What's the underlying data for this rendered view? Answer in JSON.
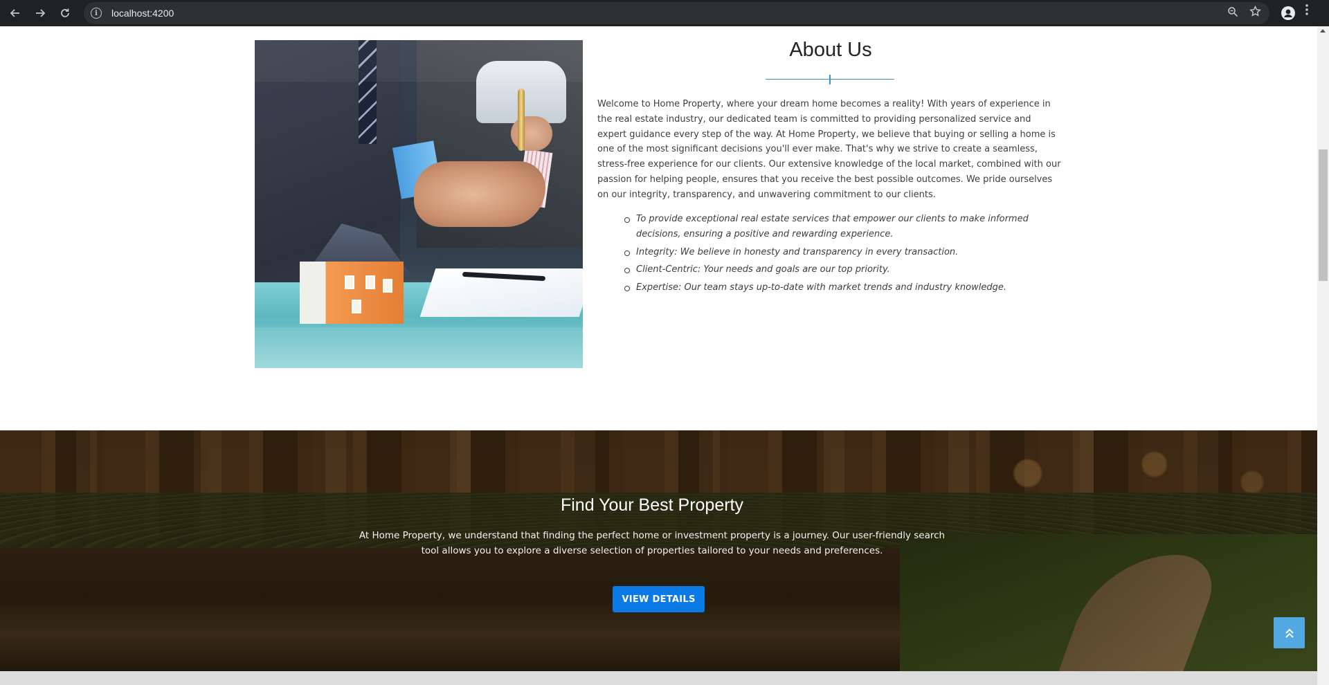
{
  "browser": {
    "url": "localhost:4200",
    "icons": {
      "back": "arrow-left-icon",
      "forward": "arrow-right-icon",
      "reload": "reload-icon",
      "site_info": "info-icon",
      "zoom": "zoom-icon",
      "bookmark": "star-icon",
      "profile": "profile-icon",
      "menu": "kebab-menu-icon"
    }
  },
  "about": {
    "title": "About Us",
    "image_alt": "Handshake over a model house and contract",
    "paragraph": "Welcome to Home Property, where your dream home becomes a reality! With years of experience in the real estate industry, our dedicated team is committed to providing personalized service and expert guidance every step of the way. At Home Property, we believe that buying or selling a home is one of the most significant decisions you'll ever make. That's why we strive to create a seamless, stress-free experience for our clients. Our extensive knowledge of the local market, combined with our passion for helping people, ensures that you receive the best possible outcomes. We pride ourselves on our integrity, transparency, and unwavering commitment to our clients.",
    "points": [
      "To provide exceptional real estate services that empower our clients to make informed decisions, ensuring a positive and rewarding experience.",
      "Integrity: We believe in honesty and transparency in every transaction.",
      "Client-Centric: Your needs and goals are our top priority.",
      "Expertise: Our team stays up-to-date with market trends and industry knowledge."
    ],
    "accent_color": "#3b8fd3"
  },
  "find": {
    "title": "Find Your Best Property",
    "text": "At Home Property, we understand that finding the perfect home or investment property is a journey. Our user-friendly search tool allows you to explore a diverse selection of properties tailored to your needs and preferences.",
    "button_label": "VIEW DETAILS",
    "button_color": "#0b7ae6"
  },
  "back_to_top": {
    "icon": "double-chevron-up-icon",
    "color": "#52a8e0"
  }
}
